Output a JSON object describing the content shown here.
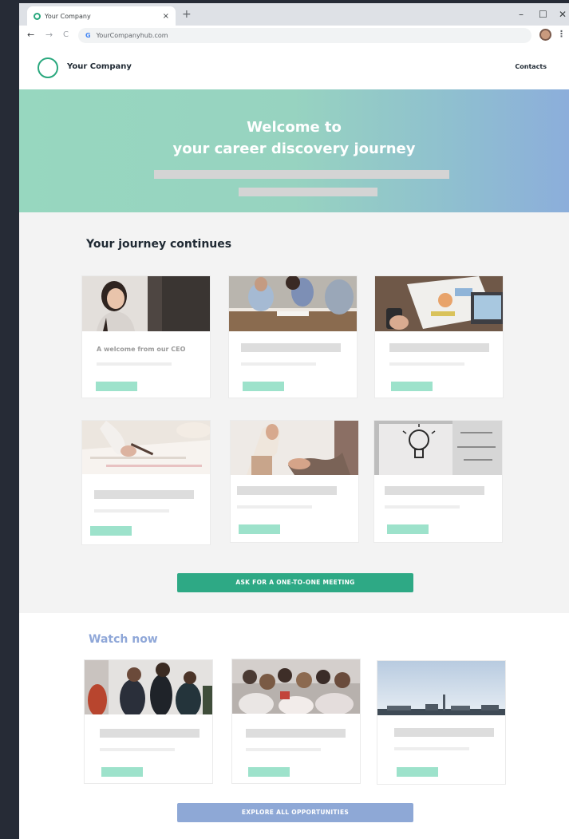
{
  "browser": {
    "tab_title": "Your Company",
    "tab_close": "×",
    "new_tab": "+",
    "url": "YourCompanyhub.com",
    "search_engine_icon": "G",
    "back_icon": "←",
    "forward_icon": "→",
    "reload_icon": "C",
    "window_controls": {
      "minimize": "–",
      "maximize": "☐",
      "close": "✕"
    },
    "menu_icon": "⋮"
  },
  "header": {
    "brand": "Your Company",
    "contacts": "Contacts"
  },
  "hero": {
    "line1": "Welcome to",
    "line2": "your career discovery journey"
  },
  "journey": {
    "title": "Your journey continues",
    "cards": [
      {
        "image": "woman-portrait",
        "title": "A welcome from our CEO"
      },
      {
        "image": "team-meeting",
        "title": ""
      },
      {
        "image": "laptop-charts",
        "title": ""
      },
      {
        "image": "writing-notes",
        "title": ""
      },
      {
        "image": "handshake",
        "title": ""
      },
      {
        "image": "lightbulb-sketch",
        "title": ""
      }
    ],
    "cta": "ASK FOR A ONE-TO-ONE MEETING"
  },
  "watch": {
    "title": "Watch now",
    "cards": [
      {
        "image": "group-discussion"
      },
      {
        "image": "audience-crowd"
      },
      {
        "image": "city-skyline"
      }
    ],
    "cta": "EXPLORE ALL OPPORTUNITIES"
  },
  "colors": {
    "brand_green": "#2ea985",
    "accent_mint": "#9de2cb",
    "accent_blue": "#8ea8d6"
  }
}
